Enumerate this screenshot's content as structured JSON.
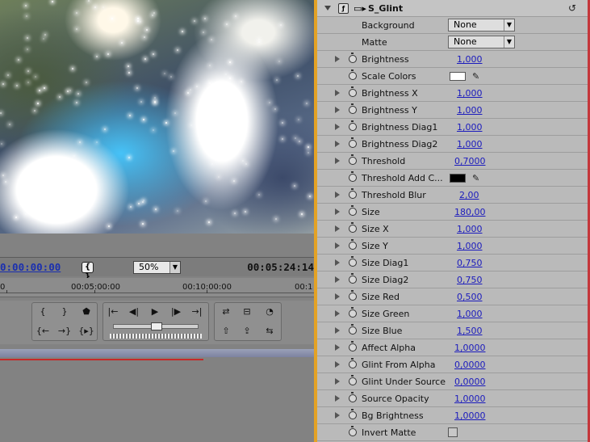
{
  "monitor": {
    "timecode_current": "0:00:00:00",
    "timecode_end": "00:05:24:14",
    "zoom": "50%",
    "ruler": [
      "0",
      "00:05:00:00",
      "00:10:00:00",
      "00:1"
    ]
  },
  "effect": {
    "name": "S_Glint",
    "params": [
      {
        "name": "Background",
        "kind": "dropdown",
        "value": "None"
      },
      {
        "name": "Matte",
        "kind": "dropdown",
        "value": "None"
      },
      {
        "name": "Brightness",
        "kind": "number",
        "value": "1,000",
        "twirl": true
      },
      {
        "name": "Scale Colors",
        "kind": "color",
        "color": "#ffffff"
      },
      {
        "name": "Brightness X",
        "kind": "number",
        "value": "1,000",
        "twirl": true
      },
      {
        "name": "Brightness Y",
        "kind": "number",
        "value": "1,000",
        "twirl": true
      },
      {
        "name": "Brightness Diag1",
        "kind": "number",
        "value": "1,000",
        "twirl": true
      },
      {
        "name": "Brightness Diag2",
        "kind": "number",
        "value": "1,000",
        "twirl": true
      },
      {
        "name": "Threshold",
        "kind": "number",
        "value": "0,7000",
        "twirl": true
      },
      {
        "name": "Threshold Add C...",
        "kind": "color",
        "color": "#000000"
      },
      {
        "name": "Threshold Blur",
        "kind": "number",
        "value": "2,00",
        "twirl": true
      },
      {
        "name": "Size",
        "kind": "number",
        "value": "180,00",
        "twirl": true
      },
      {
        "name": "Size X",
        "kind": "number",
        "value": "1,000",
        "twirl": true
      },
      {
        "name": "Size Y",
        "kind": "number",
        "value": "1,000",
        "twirl": true
      },
      {
        "name": "Size Diag1",
        "kind": "number",
        "value": "0,750",
        "twirl": true
      },
      {
        "name": "Size Diag2",
        "kind": "number",
        "value": "0,750",
        "twirl": true
      },
      {
        "name": "Size Red",
        "kind": "number",
        "value": "0,500",
        "twirl": true
      },
      {
        "name": "Size Green",
        "kind": "number",
        "value": "1,000",
        "twirl": true
      },
      {
        "name": "Size Blue",
        "kind": "number",
        "value": "1,500",
        "twirl": true
      },
      {
        "name": "Affect Alpha",
        "kind": "number",
        "value": "1,0000",
        "twirl": true
      },
      {
        "name": "Glint From Alpha",
        "kind": "number",
        "value": "0,0000",
        "twirl": true
      },
      {
        "name": "Glint Under Source",
        "kind": "number",
        "value": "0,0000",
        "twirl": true
      },
      {
        "name": "Source Opacity",
        "kind": "number",
        "value": "1,0000",
        "twirl": true
      },
      {
        "name": "Bg Brightness",
        "kind": "number",
        "value": "1,0000",
        "twirl": true
      },
      {
        "name": "Invert Matte",
        "kind": "checkbox",
        "checked": false
      }
    ]
  }
}
